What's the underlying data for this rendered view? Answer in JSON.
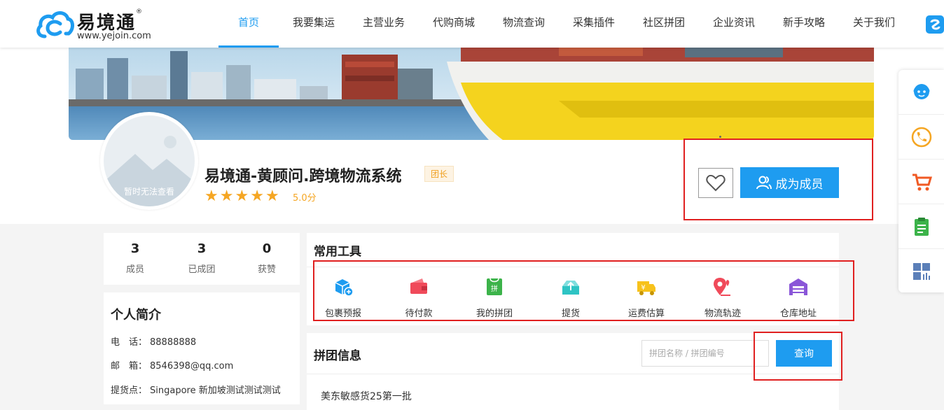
{
  "header": {
    "logo_text": "易境通",
    "logo_reg": "®",
    "logo_url": "www.yejoin.com",
    "nav": [
      {
        "label": "首页",
        "active": true
      },
      {
        "label": "我要集运",
        "active": false
      },
      {
        "label": "主营业务",
        "active": false
      },
      {
        "label": "代购商城",
        "active": false
      },
      {
        "label": "物流查询",
        "active": false
      },
      {
        "label": "采集插件",
        "active": false
      },
      {
        "label": "社区拼团",
        "active": false
      },
      {
        "label": "企业资讯",
        "active": false
      },
      {
        "label": "新手攻略",
        "active": false
      },
      {
        "label": "关于我们",
        "active": false
      }
    ]
  },
  "profile": {
    "avatar_caption": "暂时无法查看",
    "name": "易境通-黄顾问.跨境物流系统",
    "badge": "团长",
    "rating_stars": 5,
    "score": "5.0分",
    "join_label": "成为成员"
  },
  "stats": [
    {
      "value": "3",
      "label": "成员"
    },
    {
      "value": "3",
      "label": "已成团"
    },
    {
      "value": "0",
      "label": "获赞"
    }
  ],
  "intro": {
    "title": "个人简介",
    "rows": [
      {
        "label": "电　话：",
        "value": "88888888"
      },
      {
        "label": "邮　箱：",
        "value": "8546398@qq.com"
      },
      {
        "label": "提货点：",
        "value": "Singapore 新加坡测试测试测试"
      }
    ]
  },
  "tools": {
    "title": "常用工具",
    "items": [
      {
        "label": "包裹预报",
        "icon": "package-forecast-icon"
      },
      {
        "label": "待付款",
        "icon": "wallet-icon"
      },
      {
        "label": "我的拼团",
        "icon": "group-bag-icon"
      },
      {
        "label": "提货",
        "icon": "pickup-icon"
      },
      {
        "label": "运费估算",
        "icon": "truck-yen-icon"
      },
      {
        "label": "物流轨迹",
        "icon": "map-pin-icon"
      },
      {
        "label": "仓库地址",
        "icon": "warehouse-icon"
      }
    ]
  },
  "group": {
    "title": "拼团信息",
    "search_placeholder": "拼团名称 / 拼团编号",
    "query_label": "查询",
    "first_row": "美东敏感货25第一批"
  },
  "colors": {
    "primary": "#1e9cf0",
    "star": "#f5a623",
    "highlight": "#e02020"
  }
}
